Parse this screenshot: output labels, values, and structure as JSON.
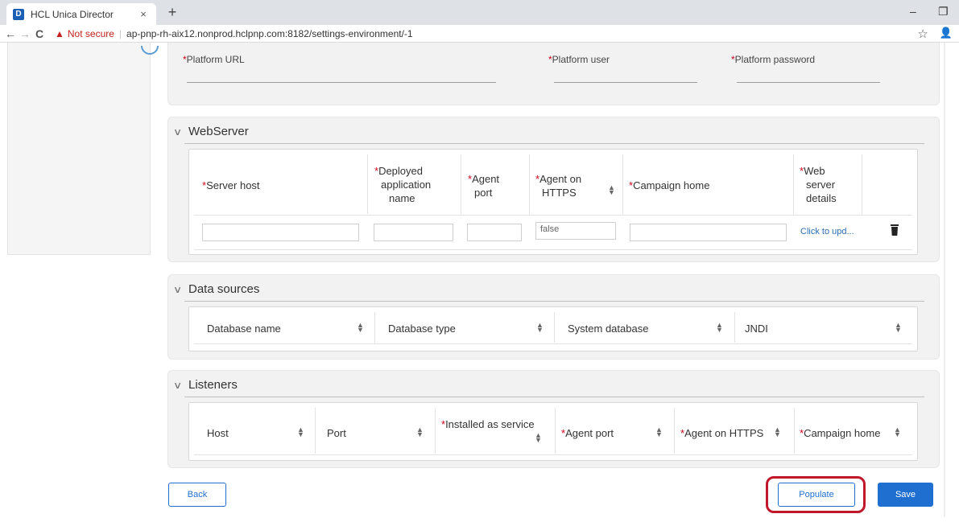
{
  "browser": {
    "tab_title": "HCL Unica Director",
    "tab_close": "×",
    "new_tab": "+",
    "favicon": "D",
    "minimize": "–",
    "restore": "❐",
    "back": "←",
    "forward": "→",
    "reload": "C",
    "warning_icon": "▲",
    "not_secure": "Not secure",
    "separator": "|",
    "url": "ap-pnp-rh-aix12.nonprod.hclpnp.com:8182/settings-environment/-1",
    "star": "☆",
    "profile": "👤"
  },
  "platform": {
    "url_label": "Platform URL",
    "user_label": "Platform user",
    "password_label": "Platform password",
    "required_mark": "*"
  },
  "webserver": {
    "title": "WebServer",
    "columns": {
      "server_host": "Server host",
      "app_name_1": "Deployed",
      "app_name_2": "application",
      "app_name_3": "name",
      "agent_port_1": "Agent",
      "agent_port_2": "port",
      "https_1": "Agent on",
      "https_2": "HTTPS",
      "campaign_home": "Campaign home",
      "details_1": "Web",
      "details_2": "server",
      "details_3": "details"
    },
    "row": {
      "agent_on_https": "false",
      "details_link": "Click to upd..."
    }
  },
  "datasources": {
    "title": "Data sources",
    "columns": [
      "Database name",
      "Database type",
      "System database",
      "JNDI"
    ]
  },
  "listeners": {
    "title": "Listeners",
    "columns": {
      "host": "Host",
      "port": "Port",
      "installed": "Installed as service",
      "agent_port": "Agent port",
      "https": "Agent on HTTPS",
      "campaign_home": "Campaign home"
    }
  },
  "actions": {
    "back": "Back",
    "populate": "Populate",
    "save": "Save"
  },
  "colors": {
    "primary": "#1f6fd1",
    "required": "#d0021b",
    "highlight": "#c0172a"
  }
}
